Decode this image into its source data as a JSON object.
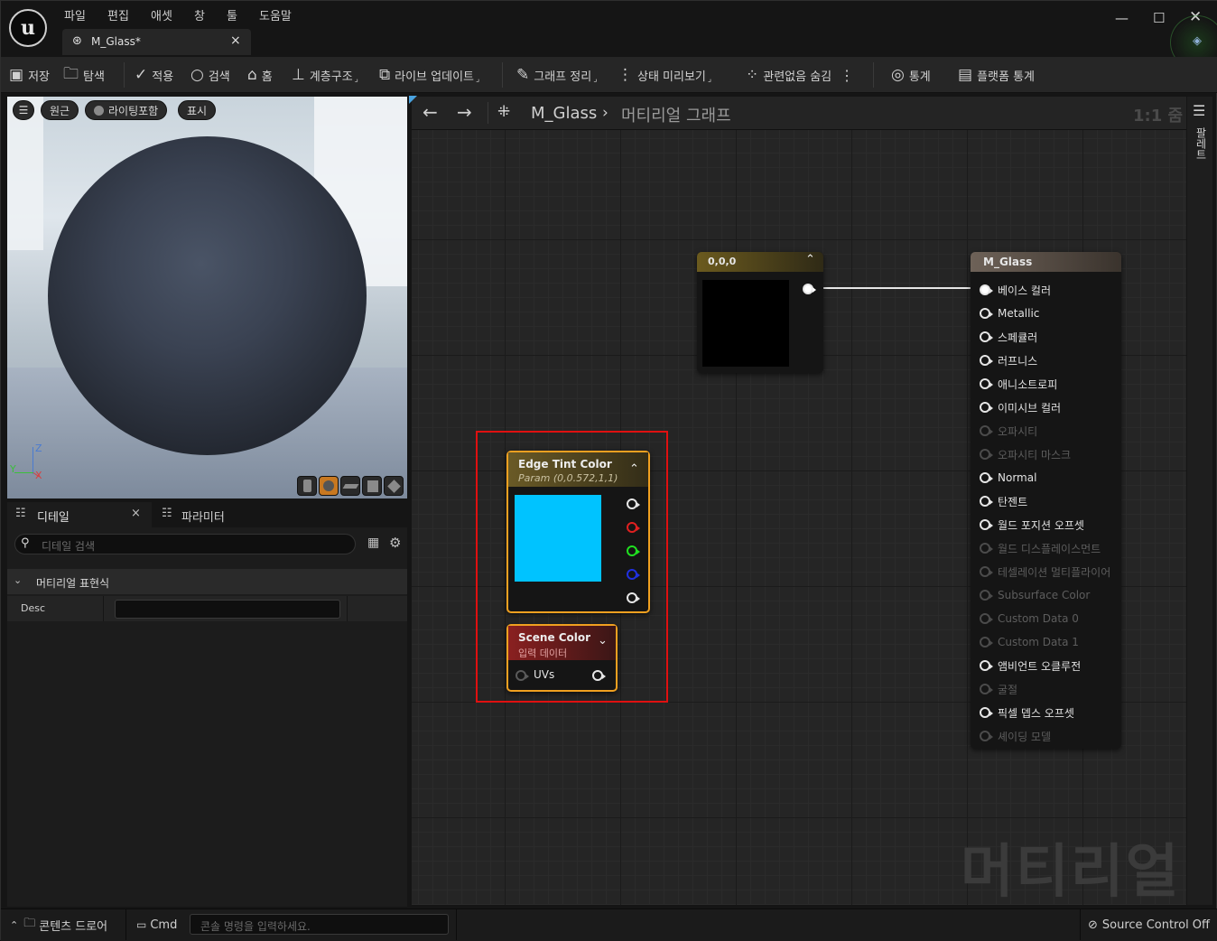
{
  "menu": [
    "파일",
    "편집",
    "애셋",
    "창",
    "툴",
    "도움말"
  ],
  "document_tab": {
    "title": "M_Glass*"
  },
  "toolbar": {
    "save": "저장",
    "browse": "탐색",
    "apply": "적용",
    "search": "검색",
    "home": "홈",
    "hierarchy": "계층구조",
    "live_update": "라이브 업데이트",
    "clean_graph": "그래프 정리",
    "preview_state": "상태 미리보기",
    "hide_unrelated": "관련없음 숨김",
    "stats": "통계",
    "platform_stats": "플랫폼 통계"
  },
  "viewport": {
    "perspective": "원근",
    "lighting": "라이팅포함",
    "show": "표시",
    "axis_x": "X",
    "axis_y": "Y",
    "axis_z": "Z"
  },
  "details": {
    "tab_details": "디테일",
    "tab_parameters": "파라미터",
    "search_placeholder": "디테일 검색",
    "section": "머티리얼 표현식",
    "desc_label": "Desc",
    "desc_value": ""
  },
  "graph": {
    "breadcrumb_asset": "M_Glass",
    "breadcrumb_graph": "머티리얼 그래프",
    "zoom": "1:1 줌",
    "watermark": "머티리얼",
    "palette": "팔레트"
  },
  "nodes": {
    "constant": {
      "title": "0,0,0",
      "color": "#000000"
    },
    "edge_tint": {
      "title": "Edge Tint Color",
      "subtitle": "Param (0,0.572,1,1)",
      "swatch": "#00c3ff"
    },
    "scene_color": {
      "title": "Scene Color",
      "subtitle": "입력 데이터",
      "input": "UVs"
    },
    "material": {
      "title": "M_Glass",
      "pins": [
        {
          "label": "베이스 컬러",
          "enabled": true,
          "connected": true
        },
        {
          "label": "Metallic",
          "enabled": true
        },
        {
          "label": "스페큘러",
          "enabled": true
        },
        {
          "label": "러프니스",
          "enabled": true
        },
        {
          "label": "애니소트로피",
          "enabled": true
        },
        {
          "label": "이미시브 컬러",
          "enabled": true
        },
        {
          "label": "오파시티",
          "enabled": false
        },
        {
          "label": "오파시티 마스크",
          "enabled": false
        },
        {
          "label": "Normal",
          "enabled": true
        },
        {
          "label": "탄젠트",
          "enabled": true
        },
        {
          "label": "월드 포지션 오프셋",
          "enabled": true
        },
        {
          "label": "월드 디스플레이스먼트",
          "enabled": false
        },
        {
          "label": "테셀레이션 멀티플라이어",
          "enabled": false
        },
        {
          "label": "Subsurface Color",
          "enabled": false
        },
        {
          "label": "Custom Data 0",
          "enabled": false
        },
        {
          "label": "Custom Data 1",
          "enabled": false
        },
        {
          "label": "앰비언트 오클루전",
          "enabled": true
        },
        {
          "label": "굴절",
          "enabled": false
        },
        {
          "label": "픽셀 뎁스 오프셋",
          "enabled": true
        },
        {
          "label": "셰이딩 모델",
          "enabled": false
        }
      ]
    }
  },
  "statusbar": {
    "content_drawer": "콘텐츠 드로어",
    "cmd": "Cmd",
    "console_placeholder": "콘솔 명령을 입력하세요.",
    "source_control": "Source Control Off"
  },
  "colors": {
    "highlight_box": "#e01010",
    "param_swatch": "#00c3ff",
    "accent": "#f0a020"
  }
}
